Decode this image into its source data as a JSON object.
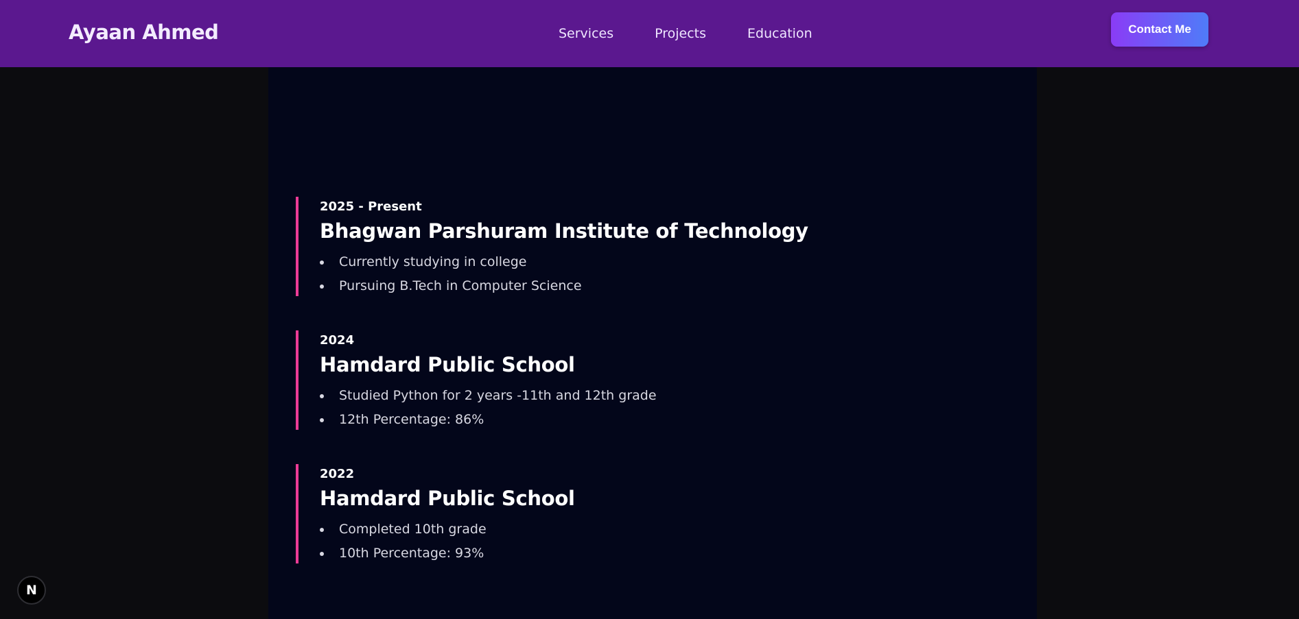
{
  "header": {
    "brand": "Ayaan Ahmed",
    "nav": [
      {
        "label": "Services"
      },
      {
        "label": "Projects"
      },
      {
        "label": "Education"
      }
    ],
    "contact_label": "Contact Me"
  },
  "education": [
    {
      "years": "2025 - Present",
      "school": "Bhagwan Parshuram Institute of Technology",
      "points": [
        "Currently studying in college",
        "Pursuing B.Tech in Computer Science"
      ]
    },
    {
      "years": "2024",
      "school": "Hamdard Public School",
      "points": [
        "Studied Python for 2 years -11th and 12th grade",
        "12th Percentage: 86%"
      ]
    },
    {
      "years": "2022",
      "school": "Hamdard Public School",
      "points": [
        "Completed 10th grade",
        "10th Percentage: 93%"
      ]
    }
  ],
  "dev_badge": {
    "letter": "N",
    "icon": "nextjs-icon"
  },
  "colors": {
    "header_bg": "#5b188f",
    "panel_bg": "#03061a",
    "accent_border": "#ec3b96",
    "button_gradient_start": "#8a3cf6",
    "button_gradient_end": "#4f7cf8"
  }
}
